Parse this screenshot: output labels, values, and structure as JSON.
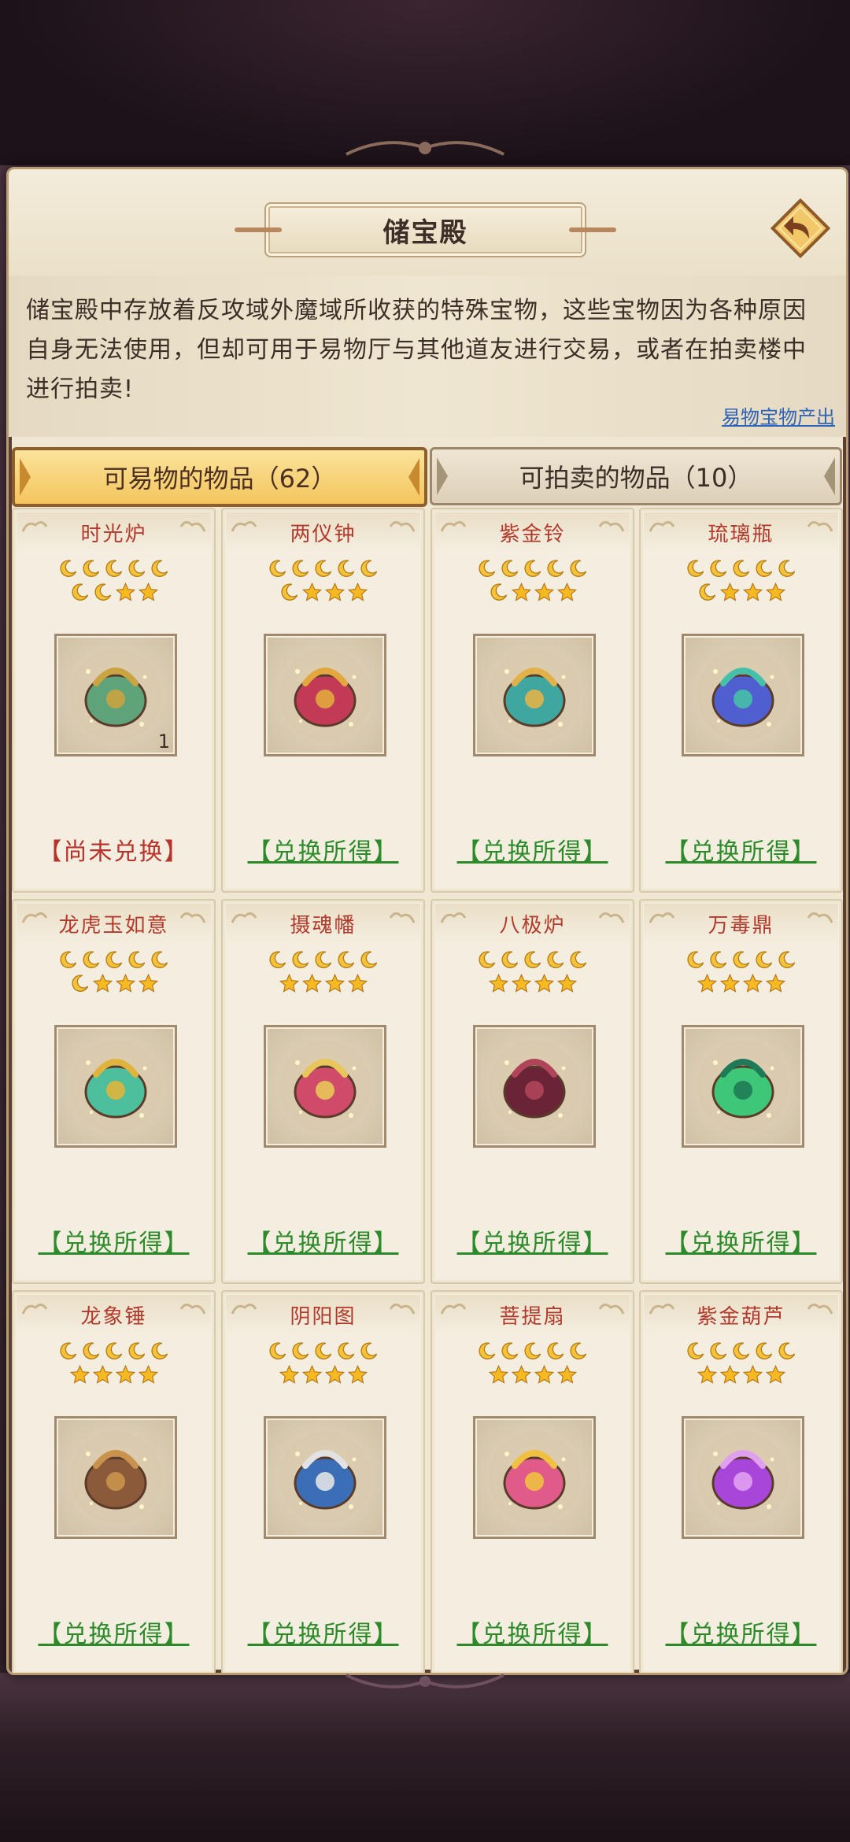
{
  "title": "储宝殿",
  "description": "储宝殿中存放着反攻域外魔域所收获的特殊宝物，这些宝物因为各种原因自身无法使用，但却可用于易物厅与其他道友进行交易，或者在拍卖楼中进行拍卖!",
  "source_link": "易物宝物产出",
  "tabs": [
    {
      "label": "可易物的物品（62）",
      "active": true
    },
    {
      "label": "可拍卖的物品（10）",
      "active": false
    }
  ],
  "items": [
    {
      "name": "时光炉",
      "moons": 7,
      "stars": 2,
      "count": "1",
      "status": "【尚未兑换】",
      "status_type": "red",
      "color": "#5fa37a",
      "accent": "#c9a441"
    },
    {
      "name": "两仪钟",
      "moons": 6,
      "stars": 3,
      "count": "",
      "status": "【兑换所得】",
      "status_type": "green",
      "color": "#c23a55",
      "accent": "#e2a83e"
    },
    {
      "name": "紫金铃",
      "moons": 6,
      "stars": 3,
      "count": "",
      "status": "【兑换所得】",
      "status_type": "green",
      "color": "#3fa7a0",
      "accent": "#e2b24a"
    },
    {
      "name": "琉璃瓶",
      "moons": 6,
      "stars": 3,
      "count": "",
      "status": "【兑换所得】",
      "status_type": "green",
      "color": "#4f5fd0",
      "accent": "#46c0a9"
    },
    {
      "name": "龙虎玉如意",
      "moons": 6,
      "stars": 3,
      "count": "",
      "status": "【兑换所得】",
      "status_type": "green",
      "color": "#4dbf9c",
      "accent": "#e0b43c"
    },
    {
      "name": "摄魂幡",
      "moons": 5,
      "stars": 4,
      "count": "",
      "status": "【兑换所得】",
      "status_type": "green",
      "color": "#d04a6a",
      "accent": "#e8c65a"
    },
    {
      "name": "八极炉",
      "moons": 5,
      "stars": 4,
      "count": "",
      "status": "【兑换所得】",
      "status_type": "green",
      "color": "#6b2337",
      "accent": "#b0455a"
    },
    {
      "name": "万毒鼎",
      "moons": 5,
      "stars": 4,
      "count": "",
      "status": "【兑换所得】",
      "status_type": "green",
      "color": "#3ec778",
      "accent": "#1f7a57"
    },
    {
      "name": "龙象锤",
      "moons": 5,
      "stars": 4,
      "count": "",
      "status": "【兑换所得】",
      "status_type": "green",
      "color": "#8a5a3a",
      "accent": "#c9924d"
    },
    {
      "name": "阴阳图",
      "moons": 5,
      "stars": 4,
      "count": "",
      "status": "【兑换所得】",
      "status_type": "green",
      "color": "#3a6fb8",
      "accent": "#e2e2e2"
    },
    {
      "name": "菩提扇",
      "moons": 5,
      "stars": 4,
      "count": "",
      "status": "【兑换所得】",
      "status_type": "green",
      "color": "#e05a8a",
      "accent": "#f0c040"
    },
    {
      "name": "紫金葫芦",
      "moons": 5,
      "stars": 4,
      "count": "",
      "status": "【兑换所得】",
      "status_type": "green",
      "color": "#a846d9",
      "accent": "#e0a0f0"
    }
  ],
  "colors": {
    "panel": "#efe7d2",
    "name_red": "#b13a2d",
    "status_green": "#2d8a2a",
    "link_blue": "#2f63b8"
  }
}
